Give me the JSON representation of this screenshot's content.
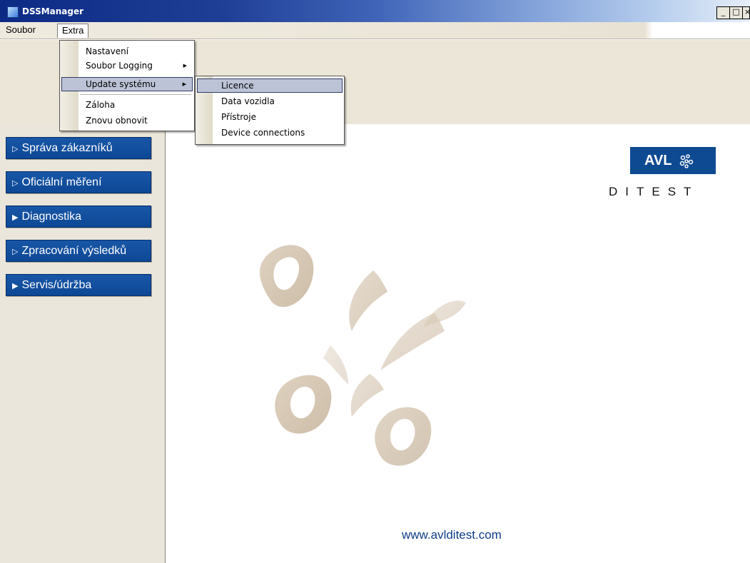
{
  "window": {
    "title": "DSSManager",
    "minimize": "_",
    "maximize": "□",
    "close": "×"
  },
  "menubar": {
    "items": [
      "Soubor",
      "Extra"
    ]
  },
  "extra_menu": {
    "items": [
      "Nastavení",
      "Soubor Logging",
      "Update systému",
      "Záloha",
      "Znovu obnovit"
    ]
  },
  "update_submenu": {
    "items": [
      "Licence",
      "Data vozidla",
      "Přístroje",
      "Device connections"
    ]
  },
  "sidebar": {
    "buttons": [
      "Správa zákazníků",
      "Oficiální měření",
      "Diagnostika",
      "Zpracování výsledků",
      "Servis/údržba"
    ]
  },
  "branding": {
    "logo": "AVL",
    "subtitle": "DITEST",
    "website": "www.avlditest.com"
  },
  "colors": {
    "nav_button": "#1856a6",
    "brand_blue": "#0d4a92",
    "menu_highlight": "#bcc3d6"
  }
}
